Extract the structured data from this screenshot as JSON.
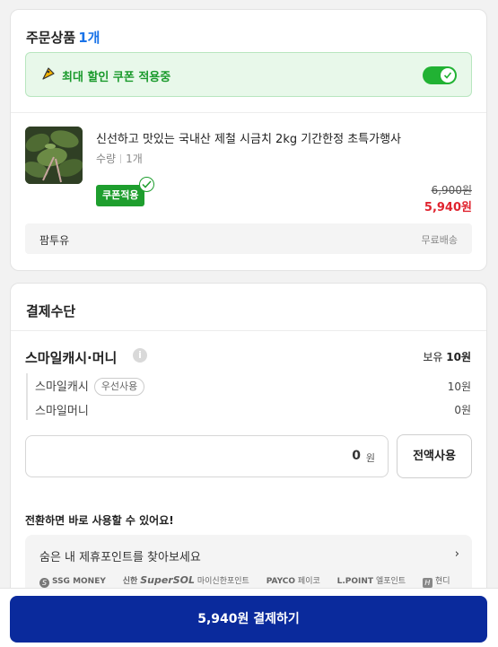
{
  "order": {
    "title": "주문상품",
    "count": "1개",
    "coupon_banner": {
      "icon": "coupon-tag-icon",
      "text": "최대 할인 쿠폰 적용중",
      "toggle_on": true
    },
    "product": {
      "name": "신선하고 맛있는 국내산 제철 시금치 2kg 기간한정 초특가행사",
      "qty_label": "수량",
      "qty_value": "1개",
      "coupon_badge": "쿠폰적용",
      "original_price": "6,900원",
      "sale_price": "5,940원"
    },
    "seller": {
      "name": "팜투유",
      "shipping": "무료배송"
    }
  },
  "payment": {
    "title": "결제수단",
    "method": {
      "name": "스마일캐시·머니",
      "balance_label": "보유",
      "balance_value": "10원",
      "rows": [
        {
          "label": "스마일캐시",
          "tag": "우선사용",
          "value": "10원"
        },
        {
          "label": "스마일머니",
          "value": "0원"
        }
      ]
    },
    "amount_input": {
      "value": "0",
      "unit": "원"
    },
    "use_all_label": "전액사용",
    "convert_title": "전환하면 바로 사용할 수 있어요!",
    "points_box": {
      "find_label": "숨은 내 제휴포인트를 찾아보세요",
      "partners": [
        "SSG MONEY",
        "신한",
        "SuperSOL",
        "마이신한포인트",
        "PAYCO",
        "페이코",
        "L.POINT",
        "엘포인트",
        "현디"
      ]
    }
  },
  "checkout": {
    "button_label": "5,940원 결제하기"
  },
  "colors": {
    "accent_blue": "#1a73e8",
    "coupon_green": "#1e9e2e",
    "sale_red": "#e0242f",
    "pay_button": "#0a2a9c"
  }
}
